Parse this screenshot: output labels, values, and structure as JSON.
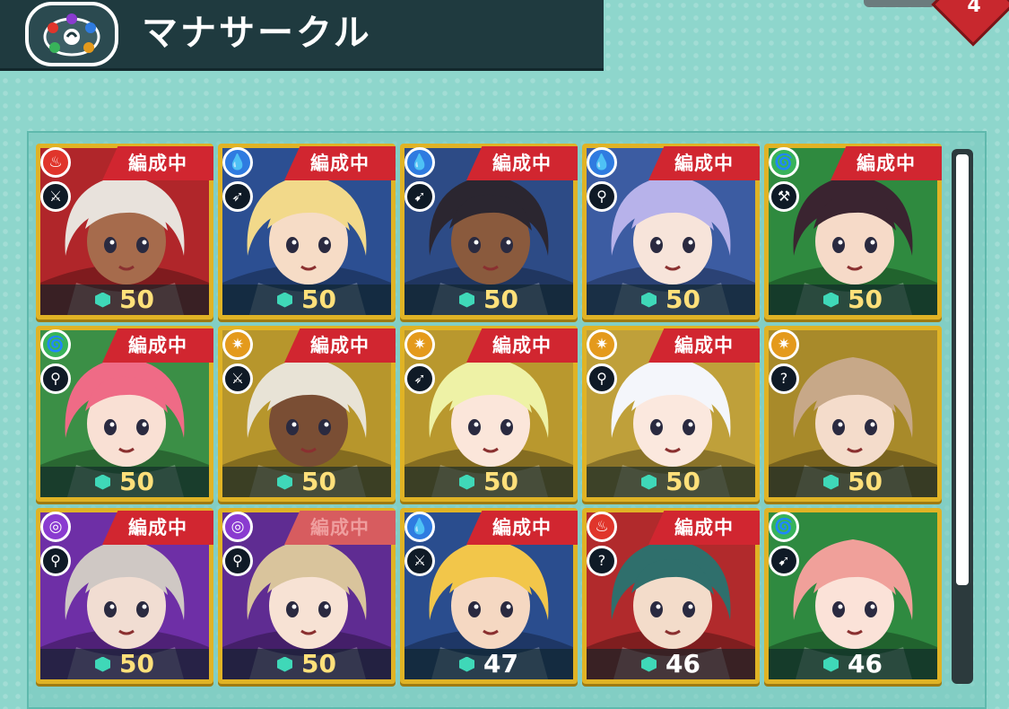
{
  "header": {
    "title": "マナサークル",
    "emblem_icon": "mana-circle-emblem-icon"
  },
  "corner_badge": "4",
  "tag_label": "編成中",
  "colors": {
    "flame": "#e0352b",
    "water": "#2f7be0",
    "wind": "#38b35a",
    "light": "#e49a1c",
    "shadow": "#8a3bd0"
  },
  "adventurers": [
    {
      "element": "flame",
      "weapon": "sword-icon",
      "level": "50",
      "tag": "編成中",
      "tag_faded": false,
      "bg": "#b0262a",
      "hair": "#e8e2dc",
      "skin": "#a66b4c"
    },
    {
      "element": "water",
      "weapon": "lance-icon",
      "level": "50",
      "tag": "編成中",
      "tag_faded": false,
      "bg": "#2c4f92",
      "hair": "#f2d98a",
      "skin": "#f6dcc6"
    },
    {
      "element": "water",
      "weapon": "bow-icon",
      "level": "50",
      "tag": "編成中",
      "tag_faded": false,
      "bg": "#2d4b86",
      "hair": "#2b2630",
      "skin": "#8a5a3d"
    },
    {
      "element": "water",
      "weapon": "staff-icon",
      "level": "50",
      "tag": "編成中",
      "tag_faded": false,
      "bg": "#3c5ca2",
      "hair": "#b7b2ea",
      "skin": "#f7e4da"
    },
    {
      "element": "wind",
      "weapon": "axe-icon",
      "level": "50",
      "tag": "編成中",
      "tag_faded": false,
      "bg": "#2f8a3f",
      "hair": "#3a2430",
      "skin": "#f6dac8"
    },
    {
      "element": "wind",
      "weapon": "staff-icon",
      "level": "50",
      "tag": "編成中",
      "tag_faded": false,
      "bg": "#3b8f46",
      "hair": "#ef6b86",
      "skin": "#f9e0d4"
    },
    {
      "element": "light",
      "weapon": "sword-icon",
      "level": "50",
      "tag": "編成中",
      "tag_faded": false,
      "bg": "#b7962c",
      "hair": "#e8e3d6",
      "skin": "#7a4e34"
    },
    {
      "element": "light",
      "weapon": "lance-icon",
      "level": "50",
      "tag": "編成中",
      "tag_faded": false,
      "bg": "#b9982e",
      "hair": "#eef2a6",
      "skin": "#fbe6da"
    },
    {
      "element": "light",
      "weapon": "staff-icon",
      "level": "50",
      "tag": "編成中",
      "tag_faded": false,
      "bg": "#bfa03a",
      "hair": "#f4f6fb",
      "skin": "#fbe8de"
    },
    {
      "element": "light",
      "weapon": "wand-icon",
      "level": "50",
      "tag": "",
      "tag_faded": false,
      "bg": "#a88a2a",
      "hair": "#c7a888",
      "skin": "#f4dccb"
    },
    {
      "element": "shadow",
      "weapon": "staff-icon",
      "level": "50",
      "tag": "編成中",
      "tag_faded": false,
      "bg": "#6e2fa6",
      "hair": "#cfc8c4",
      "skin": "#f1ddd2"
    },
    {
      "element": "shadow",
      "weapon": "staff-icon",
      "level": "50",
      "tag": "編成中",
      "tag_faded": true,
      "bg": "#5f2c92",
      "hair": "#d9c49c",
      "skin": "#f7e2d4"
    },
    {
      "element": "water",
      "weapon": "sword-icon",
      "level": "47",
      "tag": "編成中",
      "tag_faded": false,
      "bg": "#2a4d8e",
      "hair": "#f2c64a",
      "skin": "#f5d8c2"
    },
    {
      "element": "flame",
      "weapon": "wand-icon",
      "level": "46",
      "tag": "編成中",
      "tag_faded": false,
      "bg": "#b12a2c",
      "hair": "#2f6f6c",
      "skin": "#f3dcca"
    },
    {
      "element": "wind",
      "weapon": "bow-icon",
      "level": "46",
      "tag": "",
      "tag_faded": false,
      "bg": "#2f8a40",
      "hair": "#f0a09a",
      "skin": "#fbe2d8"
    }
  ]
}
